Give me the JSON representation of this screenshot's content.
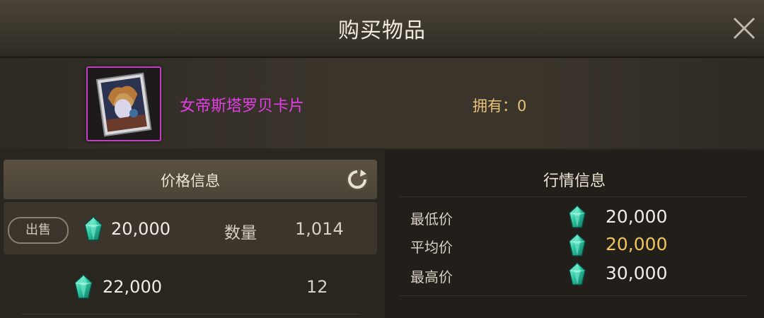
{
  "dialog": {
    "title": "购买物品"
  },
  "item": {
    "name": "女帝斯塔罗贝卡片",
    "owned_label": "拥有：0",
    "rarity_color": "#c23fc4"
  },
  "price_info": {
    "header": "价格信息",
    "sell_button": "出售",
    "quantity_label": "数量",
    "listings": [
      {
        "price": "20,000",
        "quantity": "1,014"
      },
      {
        "price": "22,000",
        "quantity": "12"
      }
    ]
  },
  "market_info": {
    "header": "行情信息",
    "rows": [
      {
        "label": "最低价",
        "value": "20,000"
      },
      {
        "label": "平均价",
        "value": "20,000"
      },
      {
        "label": "最高价",
        "value": "30,000"
      }
    ]
  },
  "colors": {
    "item_name": "#e23ee6",
    "owned": "#e9c27a",
    "average_price": "#f0c45e",
    "gem": "#3fd0b0"
  },
  "icons": {
    "close": "close-icon",
    "refresh": "refresh-icon",
    "currency": "diamond-gem-icon"
  }
}
